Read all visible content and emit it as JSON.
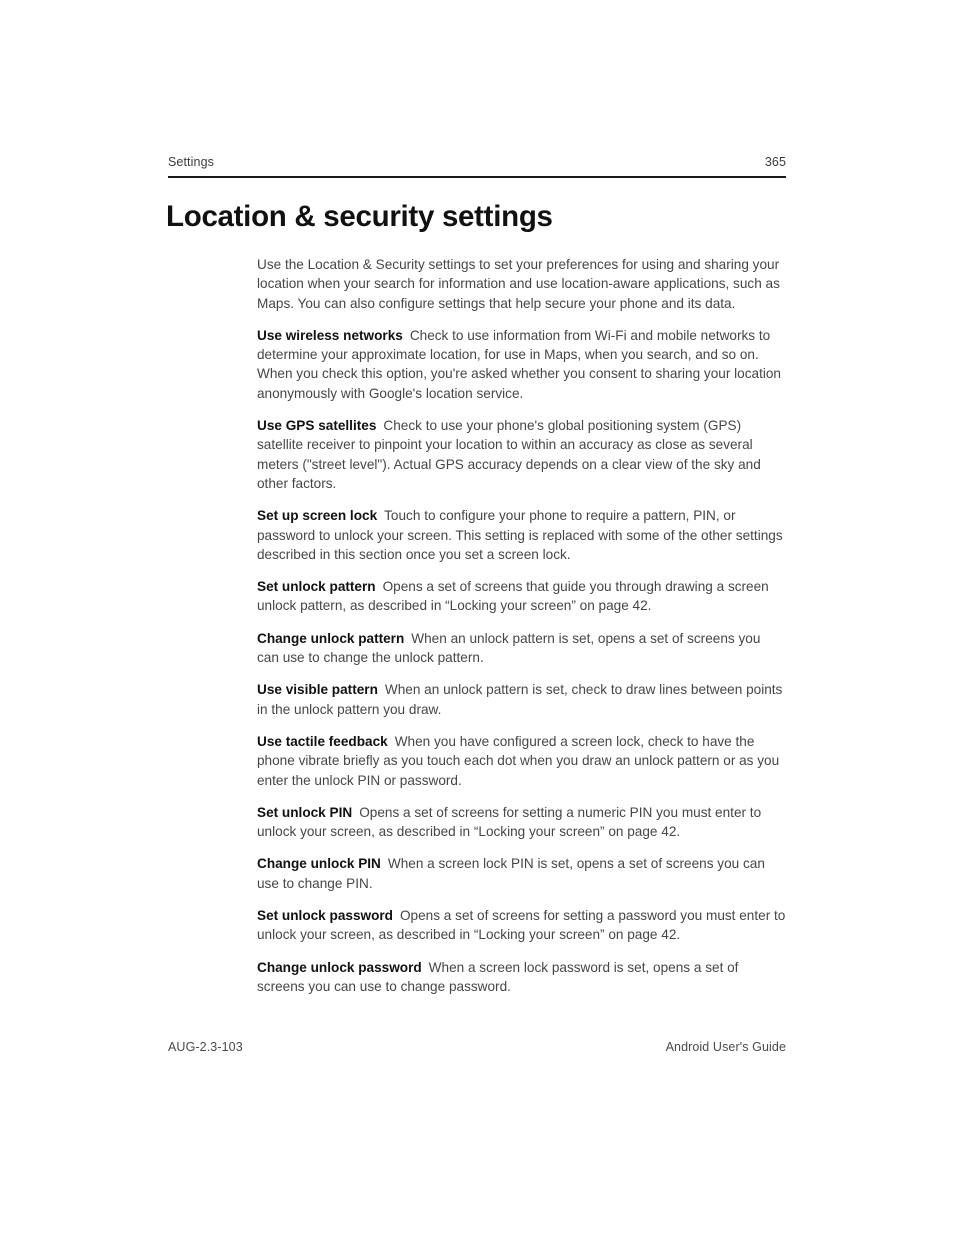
{
  "header": {
    "section_label": "Settings",
    "page_number": "365"
  },
  "title": "Location & security settings",
  "body": {
    "intro": "Use the Location & Security settings to set your preferences for using and sharing your location when your search for information and use location-aware applications, such as Maps. You can also configure settings that help secure your phone and its data.",
    "entries": [
      {
        "term": "Use wireless networks",
        "description": "Check to use information from Wi-Fi and mobile networks to determine your approximate location, for use in Maps, when you search, and so on. When you check this option, you're asked whether you consent to sharing your location anonymously with Google's location service."
      },
      {
        "term": "Use GPS satellites",
        "description": "Check to use your phone's global positioning system (GPS) satellite receiver to pinpoint your location to within an accuracy as close as several meters (\"street level\"). Actual GPS accuracy depends on a clear view of the sky and other factors."
      },
      {
        "term": "Set up screen lock",
        "description": "Touch to configure your phone to require a pattern, PIN, or password to unlock your screen. This setting is replaced with some of the other settings described in this section once you set a screen lock."
      },
      {
        "term": "Set unlock pattern",
        "description": "Opens a set of screens that guide you through drawing a screen unlock pattern, as described in “Locking your screen” on page 42."
      },
      {
        "term": "Change unlock pattern",
        "description": "When an unlock pattern is set, opens a set of screens you can use to change the unlock pattern."
      },
      {
        "term": "Use visible pattern",
        "description": "When an unlock pattern is set, check to draw lines between points in the unlock pattern you draw."
      },
      {
        "term": "Use tactile feedback",
        "description": "When you have configured a screen lock, check to have the phone vibrate briefly as you touch each dot when you draw an unlock pattern or as you enter the unlock PIN or password."
      },
      {
        "term": "Set unlock PIN",
        "description": "Opens a set of screens for setting a numeric PIN you must enter to unlock your screen, as described in “Locking your screen” on page 42."
      },
      {
        "term": "Change unlock PIN",
        "description": "When a screen lock PIN is set, opens a set of screens you can use to change PIN."
      },
      {
        "term": "Set unlock password",
        "description": "Opens a set of screens for setting a password you must enter to unlock your screen, as described in “Locking your screen” on page 42."
      },
      {
        "term": "Change unlock password",
        "description": "When a screen lock password is set, opens a set of screens you can use to change password."
      }
    ]
  },
  "footer": {
    "document_code": "AUG-2.3-103",
    "document_title": "Android User's Guide"
  }
}
